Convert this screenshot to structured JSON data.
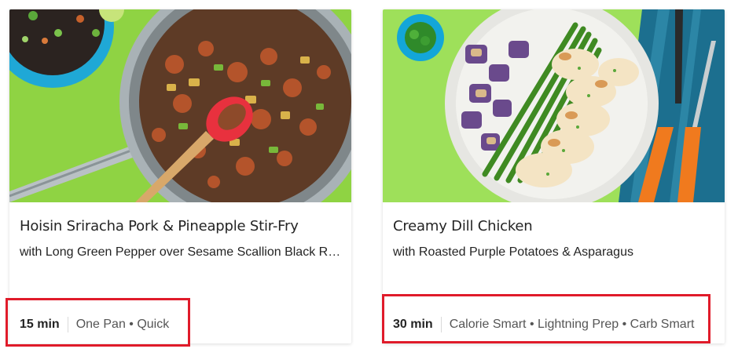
{
  "recipes": [
    {
      "title": "Hoisin Sriracha Pork & Pineapple Stir-Fry",
      "subtitle": "with Long Green Pepper over Sesame Scallion Black R…",
      "time": "15 min",
      "tags": "One Pan • Quick",
      "image_bg": "#8fd343"
    },
    {
      "title": "Creamy Dill Chicken",
      "subtitle": "with Roasted Purple Potatoes & Asparagus",
      "time": "30 min",
      "tags": "Calorie Smart • Lightning Prep • Carb Smart",
      "image_bg": "#9ee05a"
    }
  ],
  "colors": {
    "highlight": "#e01b2a",
    "title_text": "#242424",
    "tag_text": "#555555"
  }
}
